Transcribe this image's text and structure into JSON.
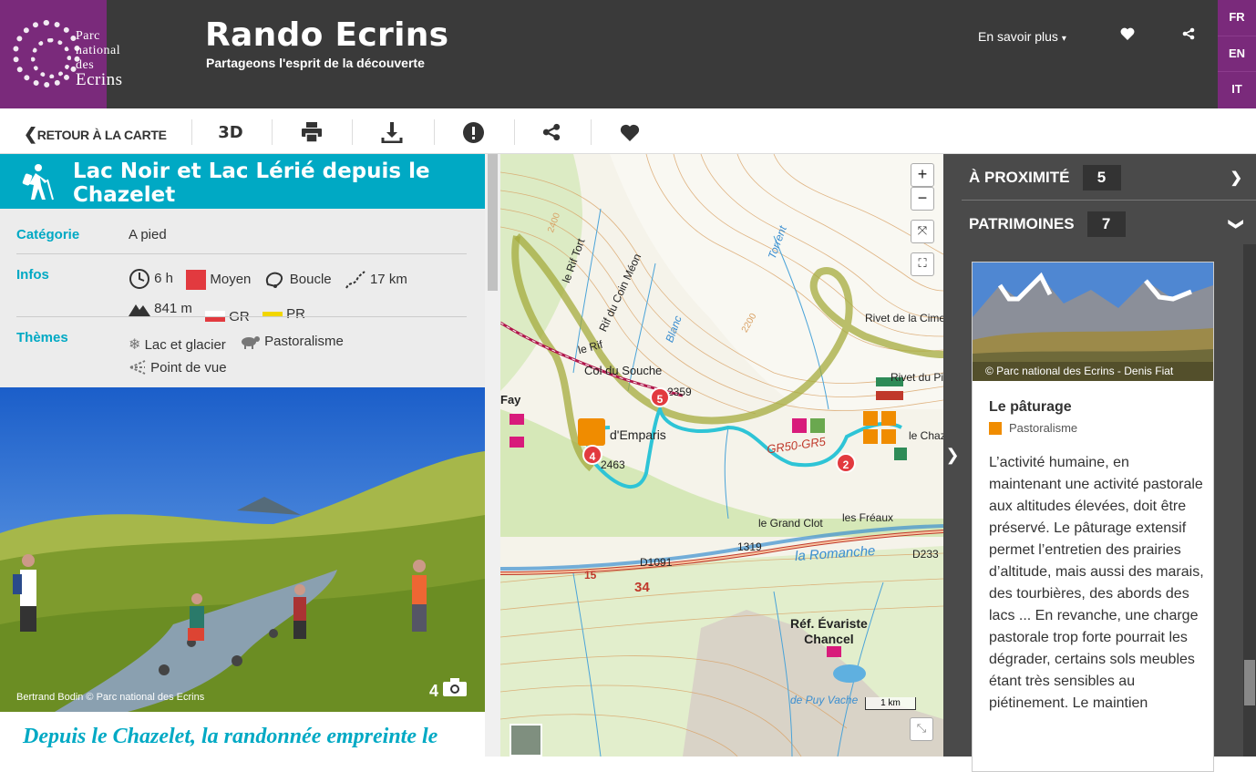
{
  "header": {
    "logo_line1": "Parc national",
    "logo_line2": "des",
    "logo_line3": "Ecrins",
    "title": "Rando Ecrins",
    "subtitle": "Partageons l'esprit de la découverte",
    "menu_label": "En savoir plus",
    "languages": [
      "FR",
      "EN",
      "IT"
    ]
  },
  "toolbar": {
    "back_label": "RETOUR À LA CARTE",
    "three_d_label": "3D"
  },
  "trek": {
    "title": "Lac Noir et Lac Lérié depuis le Chazelet",
    "category_label": "Catégorie",
    "category_value": "A pied",
    "infos_label": "Infos",
    "duration": "6 h",
    "difficulty": "Moyen",
    "route": "Boucle",
    "distance": "17 km",
    "elevation": "841 m",
    "network1": "GR",
    "network2": "PR",
    "themes_label": "Thèmes",
    "theme1": "Lac et glacier",
    "theme2": "Pastoralisme",
    "theme3": "Point de vue",
    "photo_credit": "Bertrand Bodin © Parc national des Ecrins",
    "photo_count": "4",
    "intro": "Depuis le Chazelet, la randonnée empreinte le"
  },
  "map": {
    "zoom_in": "+",
    "zoom_out": "−",
    "scale": "1 km",
    "labels": {
      "rif_tort": "le Rif Tort",
      "coin_meon": "Rif du Coin Méon",
      "rif": "le Rif",
      "blanc": "Blanc",
      "col_souche": "Col du Souche",
      "alt_2359": "2359",
      "alt_2463": "2463",
      "emparis": "d'Emparis",
      "torrent": "Torrent",
      "rivet_cime": "Rivet de la Cime",
      "rivet_pied": "Rivet du Pied",
      "chaz": "le Chaze",
      "gr50": "GR50-GR5",
      "les_freaux": "les Fréaux",
      "grand_clot": "le Grand Clot",
      "alt_1319": "1319",
      "d1091": "D1091",
      "romanche": "la Romanche",
      "d233": "D233",
      "n15": "15",
      "n34": "34",
      "ref": "Réf. Évariste",
      "chancel": "Chancel",
      "puy_vache": "de Puy Vache",
      "fay": "Fay",
      "alt_2400": "2400",
      "alt_2200": "2200"
    },
    "markers": [
      "5",
      "4",
      "2"
    ]
  },
  "sidebar": {
    "nearby_label": "À PROXIMITÉ",
    "nearby_count": "5",
    "heritage_label": "PATRIMOINES",
    "heritage_count": "7",
    "card": {
      "credit": "© Parc national des Ecrins - Denis Fiat",
      "title": "Le pâturage",
      "tag": "Pastoralisme",
      "text": "L’activité humaine, en maintenant une activité pastorale aux altitudes élevées, doit être préservé. Le pâturage extensif permet l’entretien des prairies d’altitude, mais aussi des marais, des tourbières, des abords des lacs ... En revanche, une charge pastorale trop forte pourrait les dégrader, certains sols meubles étant très sensibles au piétinement. Le maintien"
    }
  },
  "colors": {
    "brand_purple": "#7a2a7b",
    "accent_teal": "#00a9c4",
    "header_dark": "#3a3a3a",
    "difficulty_red": "#e23a3f"
  }
}
